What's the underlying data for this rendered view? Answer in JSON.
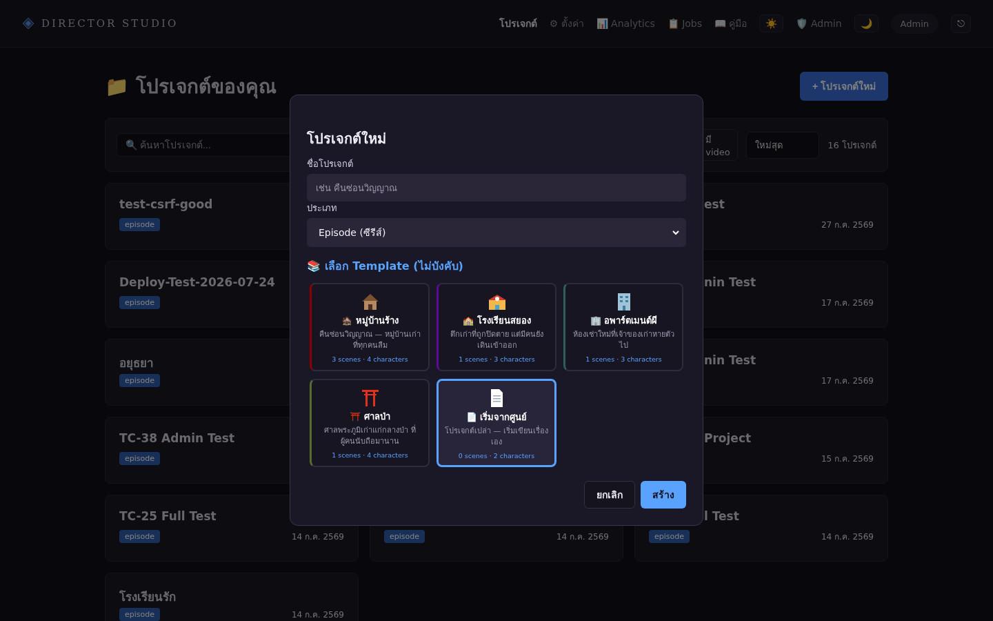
{
  "header": {
    "logo": "DIRECTOR STUDIO",
    "nav": [
      {
        "label": "โปรเจกต์",
        "selected": true
      },
      {
        "label": "⚙ ตั้งค่า",
        "selected": false
      },
      {
        "label": "📊 Analytics",
        "selected": false
      },
      {
        "label": "📋 Jobs",
        "selected": false
      },
      {
        "label": "📖 คู่มือ",
        "selected": false
      }
    ],
    "theme_light": "☀️",
    "admin_link": "🛡️ Admin",
    "theme_dark": "🌙",
    "user": "Admin",
    "logout": "⎋"
  },
  "page": {
    "title": "📁 โปรเจกต์ของคุณ",
    "new_button": "+ โปรเจกต์ใหม่"
  },
  "filters": {
    "search_placeholder": "🔍 ค้นหาโปรเจกต์...",
    "video_filter": "มี video",
    "sort": "ใหม่สุด",
    "count": "16 โปรเจกต์"
  },
  "project_rows": [
    {
      "left": {
        "title": "test-csrf-good",
        "tag": "episode"
      },
      "right": {
        "title": "est",
        "date": "27 ก.ค. 2569"
      }
    },
    {
      "left": {
        "title": "Deploy-Test-2026-07-24",
        "tag": "episode"
      },
      "right": {
        "title": "nin Test",
        "date": "17 ก.ค. 2569"
      }
    },
    {
      "left": {
        "title": "อยุธยา",
        "tag": "episode"
      },
      "right": {
        "title": "nin Test",
        "date": "17 ก.ค. 2569"
      }
    },
    {
      "left": {
        "title": "TC-38 Admin Test",
        "tag": "episode"
      },
      "right": {
        "title": "Project",
        "date": "15 ก.ค. 2569"
      }
    },
    {
      "left": {
        "title": "TC-25 Full Test",
        "tag": "episode",
        "date": "14 ก.ค. 2569"
      },
      "middle": {
        "tag": "episode",
        "date": "14 ก.ค. 2569"
      },
      "right": {
        "title": "l Test",
        "tag": "episode",
        "date": "14 ก.ค. 2569"
      }
    },
    {
      "left": {
        "title": "โรงเรียนรัก",
        "tag": "episode",
        "date": "14 ก.ค. 2569"
      }
    }
  ],
  "modal": {
    "title": "โปรเจกต์ใหม่",
    "name_label": "ชื่อโปรเจกต์",
    "name_placeholder": "เช่น คืนซ่อนวิญญาณ",
    "type_label": "ประเภท",
    "type_value": "Episode (ซีรีส์)",
    "template_heading": "📚 เลือก Template (ไม่บังคับ)",
    "templates": [
      {
        "kind": "house",
        "title": "🏚️ หมู่บ้านร้าง",
        "description": "คืนซ่อนวิญญาณ — หมู่บ้านเก่าที่ทุกคนลืม",
        "stats": "3 scenes · 4 characters",
        "color": "#8b0000",
        "selected": false
      },
      {
        "kind": "school",
        "title": "🏫 โรงเรียนสยอง",
        "description": "ตึกเก่าที่ถูกปิดตาย แต่มีคนยังเดินเข้าออก",
        "stats": "1 scenes · 3 characters",
        "color": "#5b0a91",
        "selected": false
      },
      {
        "kind": "building",
        "title": "🏢 อพาร์ตเมนต์ผี",
        "description": "ห้องเช่าใหม่ที่เจ้าของเก่าหายตัวไป",
        "stats": "1 scenes · 3 characters",
        "color": "#2f5f58",
        "selected": false
      },
      {
        "kind": "shrine",
        "title": "⛩️ ศาลป่า",
        "description": "ศาลพระภูมิเก่าแก่กลางป่า ที่ผู้คนนับถือมานาน",
        "stats": "1 scenes · 4 characters",
        "color": "#556b2f",
        "selected": false
      },
      {
        "kind": "document",
        "title": "📄 เริ่มจากศูนย์",
        "description": "โปรเจกต์เปล่า — เริ่มเขียนเรื่องเอง",
        "stats": "0 scenes · 2 characters",
        "color": "#5aa2ff",
        "selected": true
      }
    ],
    "cancel": "ยกเลิก",
    "create": "สร้าง"
  }
}
